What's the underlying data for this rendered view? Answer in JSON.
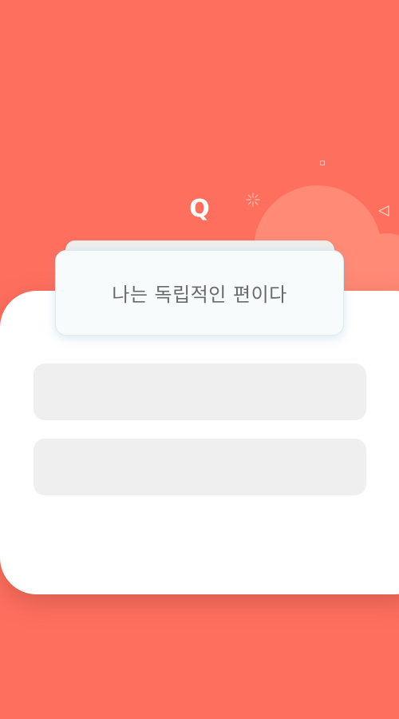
{
  "header": {
    "q_label": "Q"
  },
  "question": {
    "text": "나는 독립적인 편이다"
  },
  "answers": [
    {
      "label": ""
    },
    {
      "label": ""
    }
  ],
  "colors": {
    "background": "#ff6f5e",
    "card": "#ffffff",
    "answer_button": "#efefef",
    "question_text": "#6a6a6a"
  },
  "icons": {
    "sparkle": "sparkle-icon",
    "square": "square-icon",
    "triangle": "triangle-icon"
  }
}
